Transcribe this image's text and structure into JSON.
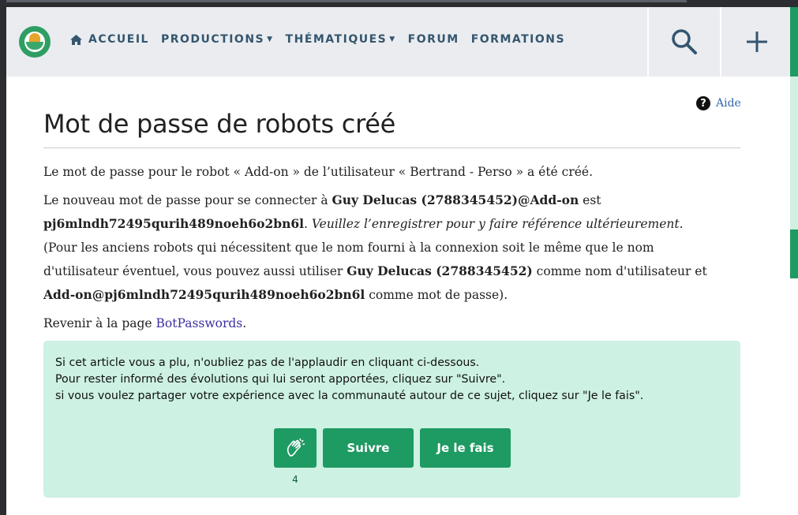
{
  "nav": {
    "home": "ACCUEIL",
    "productions": "PRODUCTIONS",
    "thematiques": "THÉMATIQUES",
    "forum": "FORUM",
    "formations": "FORMATIONS"
  },
  "header": {
    "search_icon": "search-icon",
    "add_icon": "plus-icon"
  },
  "help": {
    "label": "Aide"
  },
  "page": {
    "title": "Mot de passe de robots créé"
  },
  "message": {
    "line1": "Le mot de passe pour le robot « Add-on » de l’utilisateur « Bertrand - Perso » a été créé.",
    "p2_a": "Le nouveau mot de passe pour se connecter à ",
    "p2_login": "Guy Delucas (2788345452)@Add-on",
    "p2_b": " est",
    "p2_password": "pj6mlndh72495qurih489noeh6o2bn6l",
    "p2_c": ". ",
    "p2_note": "Veuillez l’enregistrer pour y faire référence ultérieurement.",
    "p3_a": "(Pour les anciens robots qui nécessitent que le nom fourni à la connexion soit le même que le nom",
    "p3_b": "d'utilisateur éventuel, vous pouvez aussi utiliser ",
    "p3_user": "Guy Delucas (2788345452)",
    "p3_c": " comme nom d'utilisateur et",
    "p3_combo": "Add-on@pj6mlndh72495qurih489noeh6o2bn6l",
    "p3_d": " comme mot de passe).",
    "back_a": "Revenir à la page ",
    "back_link": "BotPasswords",
    "back_b": "."
  },
  "applause": {
    "line1": "Si cet article vous a plu, n'oubliez pas de l'applaudir en cliquant ci-dessous.",
    "line2": "Pour rester informé des évolutions qui lui seront apportées, cliquez sur \"Suivre\".",
    "line3": "si vous voulez partager votre expérience avec la communauté autour de ce sujet, cliquez sur \"Je le fais\".",
    "clap_icon": "clap-icon",
    "clap_count": "4",
    "follow_label": "Suivre",
    "do_it_label": "Je le fais"
  },
  "colors": {
    "accent": "#1e9a63",
    "nav_text": "#34566e",
    "box_bg": "#cdf1e3"
  }
}
